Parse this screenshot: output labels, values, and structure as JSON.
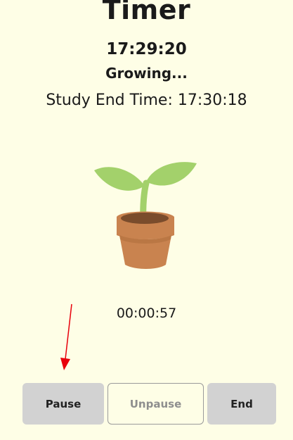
{
  "header": {
    "title": "Timer",
    "current_time": "17:29:20",
    "status": "Growing...",
    "end_time_text": "Study End Time: 17:30:18"
  },
  "timer": {
    "elapsed": "00:00:57"
  },
  "buttons": {
    "pause_label": "Pause",
    "unpause_label": "Unpause",
    "end_label": "End"
  },
  "colors": {
    "background": "#fefee6",
    "leaf": "#a3d16b",
    "pot": "#c9834f",
    "button_gray": "#d2d2d2",
    "annotation_arrow": "#e8000b"
  },
  "icons": {
    "plant": "sprout-in-pot-icon"
  }
}
